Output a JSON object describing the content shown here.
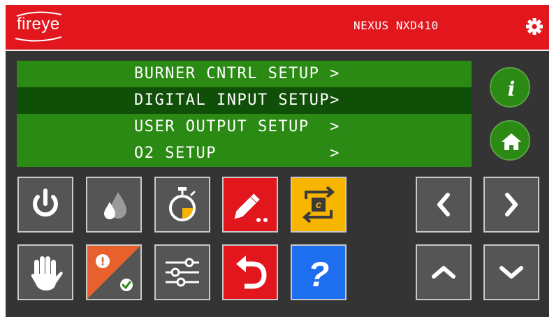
{
  "header": {
    "logo_text": "fireye",
    "device_name": "NEXUS NXD410",
    "brand_color": "#e2161d",
    "settings_icon": "gear-icon"
  },
  "menu": {
    "items": [
      {
        "label": "BURNER CNTRL SETUP >",
        "selected": false
      },
      {
        "label": "DIGITAL INPUT SETUP>",
        "selected": true
      },
      {
        "label": "USER OUTPUT SETUP  >",
        "selected": false
      },
      {
        "label": "O2 SETUP           >",
        "selected": false
      }
    ],
    "bg_color": "#2a8a13",
    "selected_color": "#0f4f08"
  },
  "side_buttons": [
    {
      "name": "info",
      "icon": "info-icon",
      "glyph": "i"
    },
    {
      "name": "home",
      "icon": "home-icon"
    }
  ],
  "toolbar": {
    "row1": [
      {
        "name": "power",
        "icon": "power-icon",
        "color": "#555555"
      },
      {
        "name": "flame",
        "icon": "flame-drop-icon",
        "color": "#555555"
      },
      {
        "name": "timer",
        "icon": "stopwatch-icon",
        "color": "#555555"
      },
      {
        "name": "edit",
        "icon": "pencil-icon",
        "color": "#e2161d"
      },
      {
        "name": "cycle",
        "icon": "cycle-c-icon",
        "color": "#f7b500",
        "glyph": "c"
      }
    ],
    "row2": [
      {
        "name": "hold",
        "icon": "hand-stop-icon",
        "color": "#555555"
      },
      {
        "name": "alarm",
        "icon": "alarm-check-icon",
        "colors": [
          "#e8602c",
          "#555555"
        ],
        "glyph": "!"
      },
      {
        "name": "adjust",
        "icon": "sliders-icon",
        "color": "#555555"
      },
      {
        "name": "undo",
        "icon": "undo-icon",
        "color": "#e2161d"
      },
      {
        "name": "help",
        "icon": "question-icon",
        "color": "#1e6ff0",
        "glyph": "?"
      }
    ]
  },
  "nav": [
    {
      "name": "left",
      "icon": "chevron-left-icon"
    },
    {
      "name": "right",
      "icon": "chevron-right-icon"
    },
    {
      "name": "up",
      "icon": "chevron-up-icon"
    },
    {
      "name": "down",
      "icon": "chevron-down-icon"
    }
  ]
}
